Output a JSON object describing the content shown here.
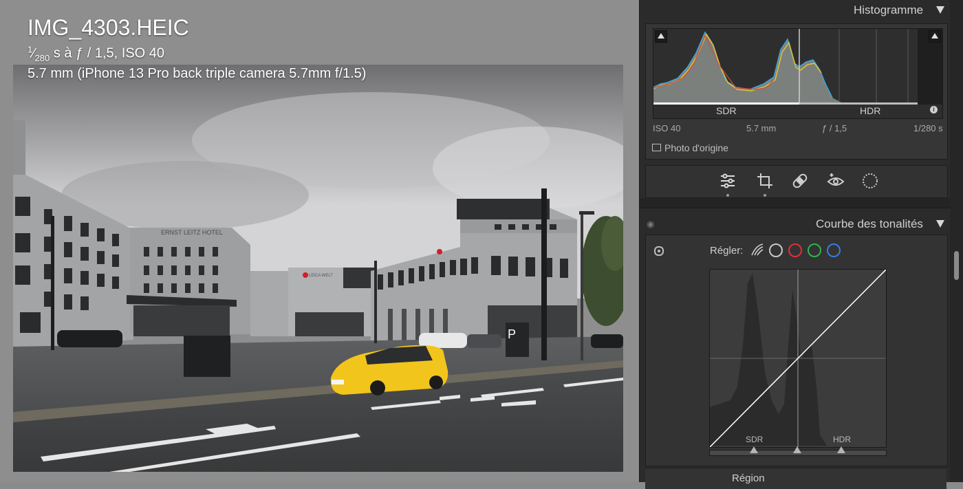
{
  "photo": {
    "filename": "IMG_4303.HEIC",
    "exposure_num": "1",
    "exposure_den": "280",
    "exposure_rest": " s à ƒ / 1,5, ISO 40",
    "camera": "5.7 mm (iPhone 13 Pro back triple camera 5.7mm f/1.5)",
    "sign_hotel": "ERNST LEITZ HOTEL",
    "sign_leica": "LEICA WELT",
    "sign_parking": "P"
  },
  "histogram": {
    "title": "Histogramme",
    "sdr_label": "SDR",
    "hdr_label": "HDR",
    "info_glyph": "i",
    "iso": "ISO 40",
    "focal": "5.7 mm",
    "aperture": "ƒ / 1,5",
    "shutter": "1/280 s",
    "original_photo_label": "Photo d'origine"
  },
  "tools": [
    {
      "name": "edit-sliders-icon"
    },
    {
      "name": "crop-icon"
    },
    {
      "name": "healing-bandage-icon"
    },
    {
      "name": "red-eye-icon"
    },
    {
      "name": "masking-icon"
    }
  ],
  "tone_curve": {
    "title": "Courbe des tonalités",
    "adjust_label": "Régler:",
    "channels": [
      {
        "name": "parametric",
        "color": "#c8c8c8"
      },
      {
        "name": "rgb",
        "color": "#c8c8c8"
      },
      {
        "name": "red",
        "color": "#e0303a"
      },
      {
        "name": "green",
        "color": "#2fb54a"
      },
      {
        "name": "blue",
        "color": "#3a7be0"
      }
    ],
    "sdr_label": "SDR",
    "hdr_label": "HDR",
    "region_label": "Région"
  },
  "colors": {
    "panel_bg": "#2b2b2b",
    "viewer_bg": "#8e8e8e",
    "taxi_yellow": "#f2c51c"
  }
}
